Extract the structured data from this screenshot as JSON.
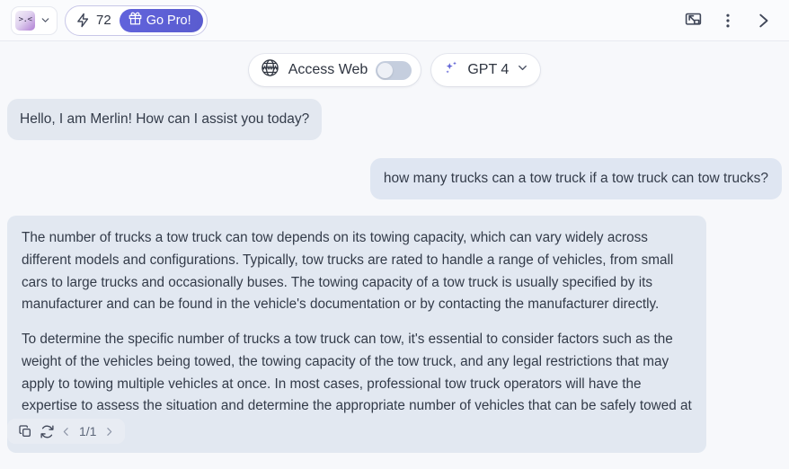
{
  "header": {
    "avatar_glyph": ">.<",
    "avatar_icon": "user-avatar-icon",
    "profile_chevron_icon": "chevron-down-icon",
    "credits": {
      "bolt_icon": "lightning-bolt-icon",
      "count": "72",
      "gift_icon": "gift-icon",
      "go_pro_label": "Go Pro!"
    },
    "icons": {
      "minimize": "minimize-window-icon",
      "more": "more-vertical-icon",
      "collapse": "chevron-right-icon"
    }
  },
  "toolbar": {
    "access_web": {
      "icon": "globe-www-icon",
      "label": "Access Web",
      "toggle_on": false
    },
    "model": {
      "icon": "sparkles-icon",
      "label": "GPT 4",
      "chevron_icon": "chevron-down-icon"
    }
  },
  "chat": {
    "messages": [
      {
        "role": "assistant",
        "type": "greeting",
        "text": "Hello, I am Merlin! How can I assist you today?"
      },
      {
        "role": "user",
        "type": "question",
        "text": "how many trucks can a tow truck if a tow truck can tow trucks?"
      },
      {
        "role": "assistant",
        "type": "answer",
        "paragraphs": [
          "The number of trucks a tow truck can tow depends on its towing capacity, which can vary widely across different models and configurations. Typically, tow trucks are rated to handle a range of vehicles, from small cars to large trucks and occasionally buses. The towing capacity of a tow truck is usually specified by its manufacturer and can be found in the vehicle's documentation or by contacting the manufacturer directly.",
          "To determine the specific number of trucks a tow truck can tow, it's essential to consider factors such as the weight of the vehicles being towed, the towing capacity of the tow truck, and any legal restrictions that may apply to towing multiple vehicles at once. In most cases, professional tow truck operators will have the expertise to assess the situation and determine the appropriate number of vehicles that can be safely towed at one time."
        ]
      }
    ]
  },
  "action_bar": {
    "copy_icon": "copy-icon",
    "regenerate_icon": "refresh-icon",
    "prev_icon": "chevron-left-icon",
    "page_indicator": "1/1",
    "next_icon": "chevron-right-icon"
  },
  "colors": {
    "accent_purple": "#5d5fd6",
    "bubble_assistant": "#e3e8f0",
    "bubble_user": "#dfe6f2",
    "bubble_answer": "#e2e8f1",
    "page_background": "#f7f8fb",
    "text_primary": "#333b49"
  }
}
